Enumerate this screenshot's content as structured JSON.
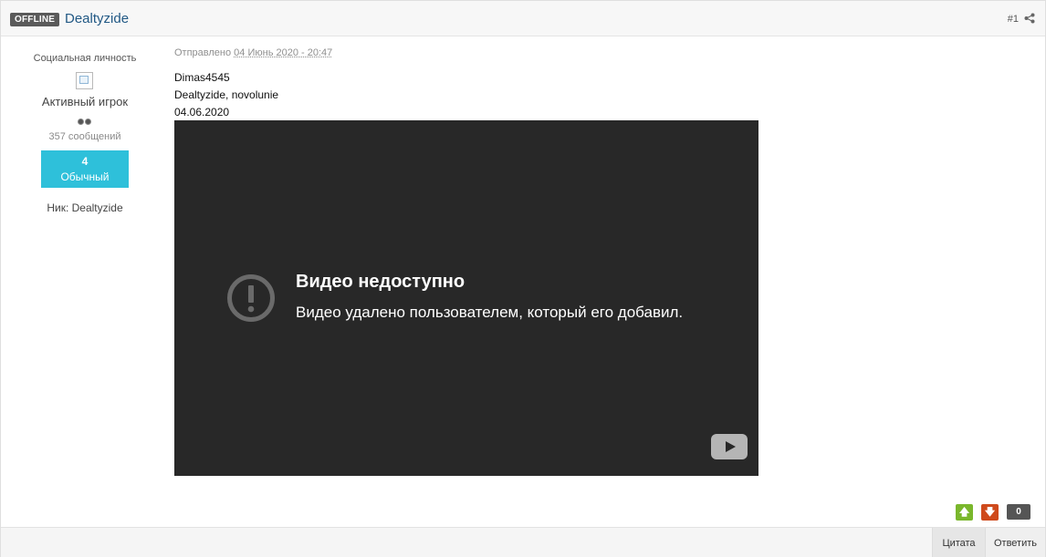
{
  "header": {
    "status_badge": "OFFLINE",
    "author_name": "Dealtyzide",
    "post_number": "#1",
    "share_icon": "share-icon"
  },
  "author": {
    "title": "Социальная личность",
    "rank_image_icon": "broken-image-icon",
    "group": "Активный игрок",
    "pips": 2,
    "post_count": "357 сообщений",
    "reputation_value": "4",
    "reputation_label": "Обычный",
    "nick": "Ник: Dealtyzide",
    "reputation_color": "#2ec0da"
  },
  "post": {
    "posted_label": "Отправлено",
    "posted_date": "04 Июнь 2020 - 20:47",
    "lines": [
      "Dimas4545",
      "Dealtyzide, novolunie",
      "04.06.2020"
    ]
  },
  "video": {
    "title": "Видео недоступно",
    "description": "Видео удалено пользователем, который его добавил.",
    "warning_icon": "exclamation-circle-icon",
    "play_icon": "youtube-play-icon",
    "background": "#282828"
  },
  "reputation_controls": {
    "up_symbol": "🡅",
    "down_symbol": "🡇",
    "count": "0",
    "up_color": "#7ab72c",
    "down_color": "#cf4a1c"
  },
  "footer": {
    "quote_label": "Цитата",
    "reply_label": "Ответить"
  }
}
